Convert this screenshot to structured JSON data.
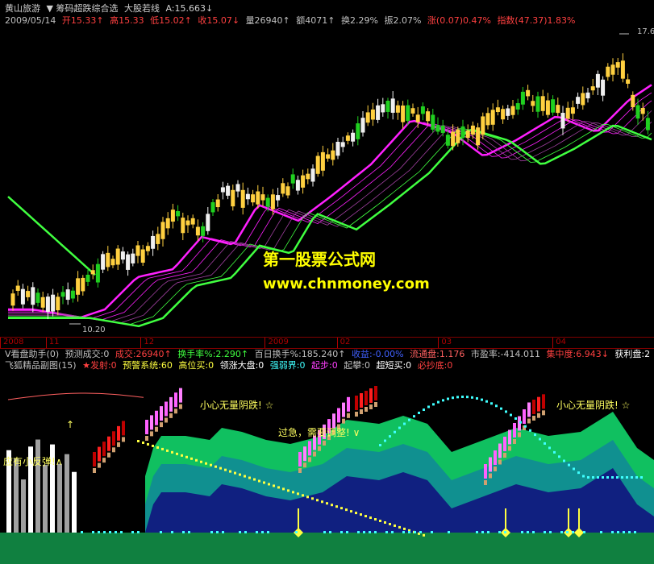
{
  "header": {
    "stock_name": "黄山旅游",
    "indicator_name": "▼ 筹码超跌综合选",
    "line_name": "大股若线",
    "price_label": "A:15.663↓"
  },
  "quote": {
    "date": "2009/05/14",
    "open": "开15.33↑",
    "high": "高15.33",
    "low": "低15.02↑",
    "close": "收15.07↓",
    "volume": "量26940↑",
    "amount": "额4071↑",
    "turnover": "换2.29%",
    "amplitude": "振2.07%",
    "change": "涨(0.07)0.47%",
    "index": "指数(47.37)1.83%"
  },
  "main_chart": {
    "high_label": "17.6",
    "low_label": "10.20"
  },
  "time_axis": [
    {
      "label": "2008",
      "pos": 0.0
    },
    {
      "label": "11",
      "pos": 0.07
    },
    {
      "label": "12",
      "pos": 0.215
    },
    {
      "label": "2009",
      "pos": 0.405
    },
    {
      "label": "02",
      "pos": 0.515
    },
    {
      "label": "03",
      "pos": 0.67
    },
    {
      "label": "04",
      "pos": 0.845
    }
  ],
  "indicator1": {
    "name": "V看盘助手(0)",
    "forecast": "预测成交:0",
    "volume": "成交:26940↑",
    "turnover": "换手率%:2.290↑",
    "day100": "百日换手%:185.240↑",
    "gain": "收益:-0.00%",
    "float_cap": "流通盘:1.176",
    "pe": "市盈率:-414.011",
    "concentration": "集中度:6.943↓",
    "profit": "获利盘:2"
  },
  "indicator2": {
    "name": "飞狐精品副图(15)",
    "launch": "★发射:0",
    "warning": "预警系统:60",
    "high_buy": "高位买:0",
    "lead": "领涨大盘:0",
    "strength": "强弱界:0",
    "start": "起步:0",
    "rise": "起攀:0",
    "short": "超短买:0",
    "bottom": "必抄底:0"
  },
  "annotations": {
    "rebound": "应有小反弹!∧",
    "careful1": "小心无量阴跌! ☆",
    "careful2": "小心无量阴跌! ☆",
    "surge": "过急，需要调整! ∨"
  },
  "watermark": {
    "line1": "第一股票公式网",
    "line2": "www.chnmoney.com"
  },
  "colors": {
    "up": "#ffd040",
    "down": "#20d020",
    "magenta": "#ff20ff",
    "green": "#40ff40"
  }
}
